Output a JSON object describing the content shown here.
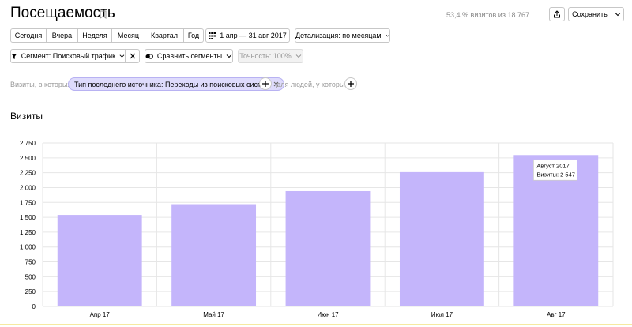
{
  "header": {
    "title": "Посещаемость",
    "summary": "53,4 % визитов из 18 767",
    "save_label": "Сохранить"
  },
  "periods": [
    "Сегодня",
    "Вчера",
    "Неделя",
    "Месяц",
    "Квартал",
    "Год"
  ],
  "date_range": "1 апр — 31 авг 2017",
  "detail": "Детализация: по месяцам",
  "segment": "Сегмент: Поисковый трафик",
  "compare": "Сравнить сегменты",
  "accuracy": "Точность: 100%",
  "filters": {
    "visits_label": "Визиты, в которых",
    "chip": "Тип последнего источника: Переходы из поисковых систем",
    "people_label": "для людей, у которых"
  },
  "section_title": "Визиты",
  "tooltip": {
    "title": "Август 2017",
    "value": "Визиты: 2 547"
  },
  "colors": {
    "bar": "#c4b5fb",
    "chip_bg": "#dedbfc",
    "grid": "#e6e6e6"
  },
  "chart_data": {
    "type": "bar",
    "categories": [
      "Апр 17",
      "Май 17",
      "Июн 17",
      "Июл 17",
      "Авг 17"
    ],
    "values": [
      1540,
      1720,
      1940,
      2260,
      2547
    ],
    "ylim": [
      0,
      2750
    ],
    "yticks": [
      0,
      250,
      500,
      750,
      1000,
      1250,
      1500,
      1750,
      2000,
      2250,
      2500,
      2750
    ],
    "ytick_labels": [
      "0",
      "250",
      "500",
      "750",
      "1 000",
      "1 250",
      "1 500",
      "1 750",
      "2 000",
      "2 250",
      "2 500",
      "2 750"
    ],
    "grid": true
  }
}
